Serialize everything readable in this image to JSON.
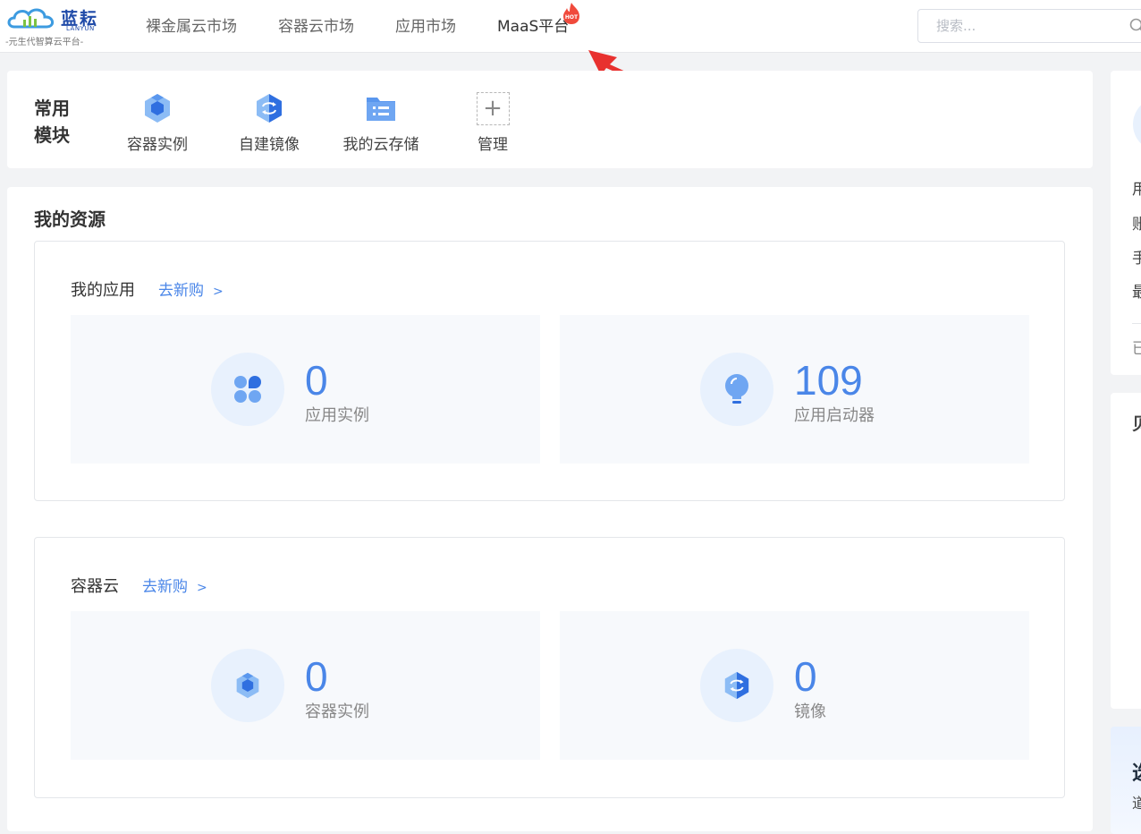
{
  "brand": {
    "name": "蓝耘",
    "name_en": "LANYUN",
    "slogan": "-元生代智算云平台-"
  },
  "nav": {
    "items": [
      {
        "label": "裸金属云市场"
      },
      {
        "label": "容器云市场"
      },
      {
        "label": "应用市场"
      },
      {
        "label": "MaaS平台",
        "badge": "HOT"
      }
    ]
  },
  "search": {
    "placeholder": "搜索..."
  },
  "modules": {
    "title": "常用\n模块",
    "items": [
      {
        "label": "容器实例",
        "icon": "container-instance-icon"
      },
      {
        "label": "自建镜像",
        "icon": "image-icon"
      },
      {
        "label": "我的云存储",
        "icon": "cloud-storage-icon"
      },
      {
        "label": "管理",
        "icon": "plus-icon"
      }
    ]
  },
  "resources": {
    "title": "我的资源",
    "apps": {
      "name": "我的应用",
      "link": "去新购",
      "stats": [
        {
          "value": "0",
          "label": "应用实例",
          "icon": "app-grid-icon"
        },
        {
          "value": "109",
          "label": "应用启动器",
          "icon": "lightbulb-icon"
        }
      ]
    },
    "container": {
      "name": "容器云",
      "link": "去新购",
      "stats": [
        {
          "value": "0",
          "label": "容器实例",
          "icon": "container-instance-icon"
        },
        {
          "value": "0",
          "label": "镜像",
          "icon": "image-icon"
        }
      ]
    }
  },
  "right_panel": {
    "rows": [
      "用",
      "账",
      "手",
      "最",
      "已"
    ],
    "card2_title": "贝",
    "card3_title": "选",
    "card3_sub": "道"
  },
  "colors": {
    "accent": "#4a86e8",
    "annotation": "#e8312f",
    "background": "#f2f3f5"
  }
}
